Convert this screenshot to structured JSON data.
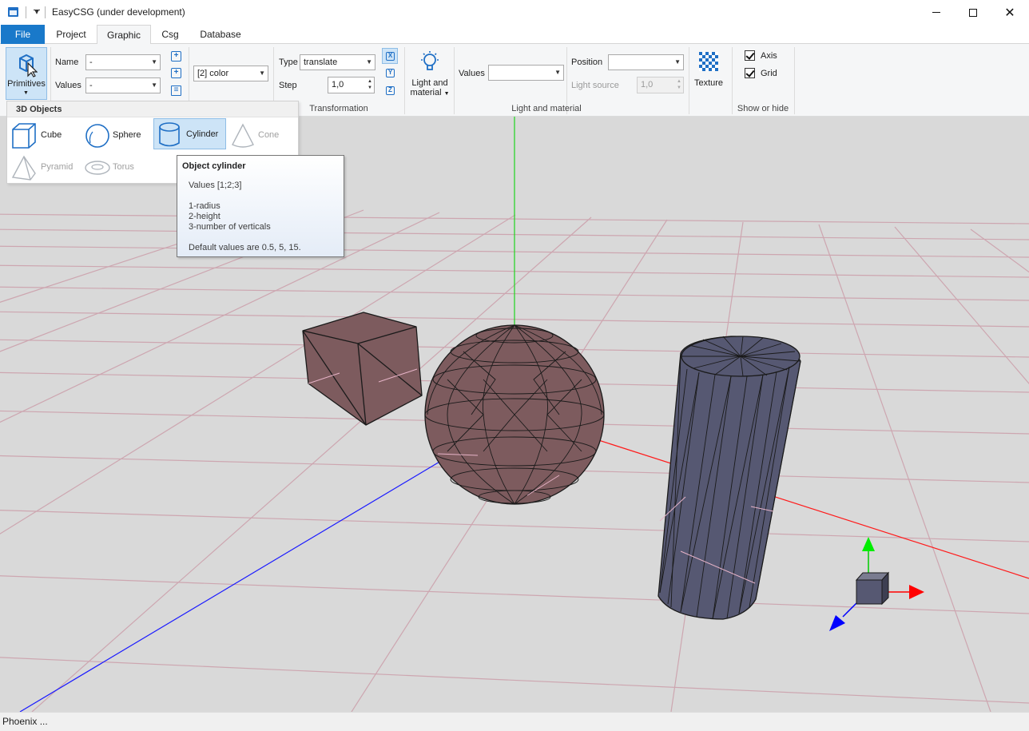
{
  "window": {
    "title": "EasyCSG (under development)"
  },
  "tabs": [
    {
      "label": "File"
    },
    {
      "label": "Project"
    },
    {
      "label": "Graphic"
    },
    {
      "label": "Csg"
    },
    {
      "label": "Database"
    }
  ],
  "ribbon": {
    "primitives": {
      "label": "Primitives"
    },
    "name": {
      "label": "Name",
      "value": "-"
    },
    "values": {
      "label": "Values",
      "value": "-"
    },
    "color_combo": {
      "value": "[2] color"
    },
    "transformation": {
      "type_label": "Type",
      "type_value": "translate",
      "step_label": "Step",
      "step_value": "1,0",
      "group_label": "Transformation",
      "axes": [
        "X",
        "Y",
        "Z"
      ]
    },
    "light": {
      "button_label_1": "Light and",
      "button_label_2": "material",
      "values_label": "Values",
      "values_value": "",
      "position_label": "Position",
      "position_value": "",
      "light_source_label": "Light source",
      "light_source_value": "1,0",
      "group_label": "Light and material"
    },
    "texture": {
      "label": "Texture"
    },
    "show_hide": {
      "axis_label": "Axis",
      "axis_checked": true,
      "grid_label": "Grid",
      "grid_checked": true,
      "group_label": "Show or hide"
    }
  },
  "gallery": {
    "header": "3D Objects",
    "items": [
      {
        "label": "Cube",
        "enabled": true
      },
      {
        "label": "Sphere",
        "enabled": true
      },
      {
        "label": "Cylinder",
        "enabled": true,
        "selected": true
      },
      {
        "label": "Cone",
        "enabled": false
      },
      {
        "label": "Pyramid",
        "enabled": false
      },
      {
        "label": "Torus",
        "enabled": false
      }
    ]
  },
  "tooltip": {
    "title": "Object cylinder",
    "lines": [
      "Values [1;2;3]",
      "1-radius",
      "2-height",
      "3-number of verticals",
      "Default values are 0.5, 5, 15."
    ]
  },
  "status": {
    "text": "Phoenix ..."
  },
  "colors": {
    "accent": "#1979ca",
    "cube_sphere_fill": "#7d5b5e",
    "cylinder_fill": "#565872",
    "grid_line": "#c9a3ad",
    "viewport_bg": "#d9d9d9",
    "axis_x": "#ff0000",
    "axis_y": "#00cc00",
    "axis_z": "#0000ff"
  }
}
